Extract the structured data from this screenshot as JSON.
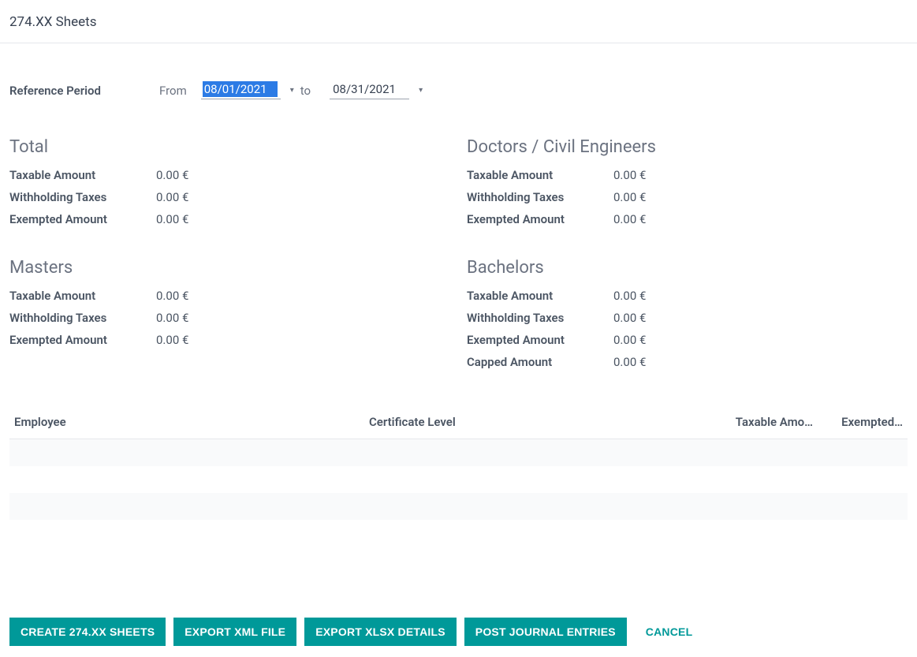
{
  "title": "274.XX Sheets",
  "period": {
    "label": "Reference Period",
    "from_label": "From",
    "to_label": "to",
    "from_value": "08/01/2021",
    "to_value": "08/31/2021"
  },
  "sections": {
    "total": {
      "title": "Total",
      "taxable_label": "Taxable Amount",
      "taxable_value": "0.00 €",
      "withholding_label": "Withholding Taxes",
      "withholding_value": "0.00 €",
      "exempted_label": "Exempted Amount",
      "exempted_value": "0.00 €"
    },
    "doctors": {
      "title": "Doctors / Civil Engineers",
      "taxable_label": "Taxable Amount",
      "taxable_value": "0.00 €",
      "withholding_label": "Withholding Taxes",
      "withholding_value": "0.00 €",
      "exempted_label": "Exempted Amount",
      "exempted_value": "0.00 €"
    },
    "masters": {
      "title": "Masters",
      "taxable_label": "Taxable Amount",
      "taxable_value": "0.00 €",
      "withholding_label": "Withholding Taxes",
      "withholding_value": "0.00 €",
      "exempted_label": "Exempted Amount",
      "exempted_value": "0.00 €"
    },
    "bachelors": {
      "title": "Bachelors",
      "taxable_label": "Taxable Amount",
      "taxable_value": "0.00 €",
      "withholding_label": "Withholding Taxes",
      "withholding_value": "0.00 €",
      "exempted_label": "Exempted Amount",
      "exempted_value": "0.00 €",
      "capped_label": "Capped Amount",
      "capped_value": "0.00 €"
    }
  },
  "table": {
    "col_employee": "Employee",
    "col_certificate": "Certificate Level",
    "col_taxable": "Taxable Amo…",
    "col_exempted": "Exempted…"
  },
  "footer": {
    "create": "CREATE 274.XX SHEETS",
    "export_xml": "EXPORT XML FILE",
    "export_xlsx": "EXPORT XLSX DETAILS",
    "post": "POST JOURNAL ENTRIES",
    "cancel": "CANCEL"
  }
}
